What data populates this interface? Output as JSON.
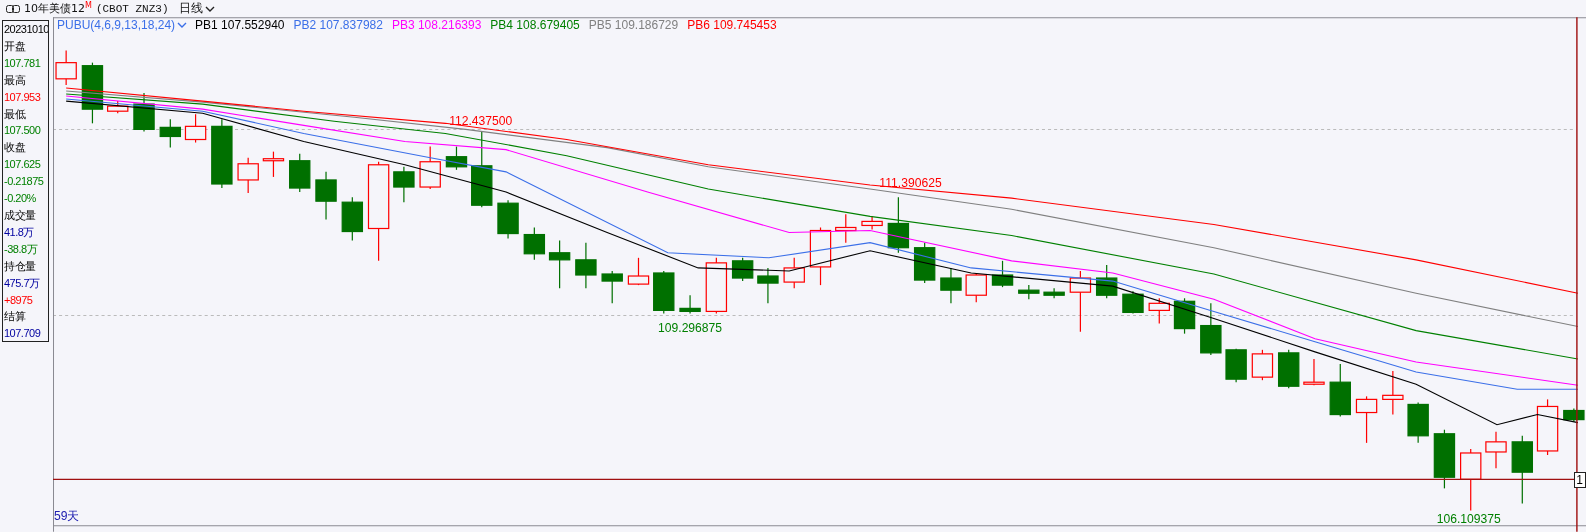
{
  "header": {
    "title": "10年美债12",
    "title_mark": "M",
    "symbol": "(CBOT ZNZ3)",
    "period": "日线"
  },
  "info_panel": [
    {
      "text": "20231010",
      "kind": "label"
    },
    {
      "text": "开盘",
      "kind": "label"
    },
    {
      "text": "107.781",
      "kind": "down"
    },
    {
      "text": "最高",
      "kind": "label"
    },
    {
      "text": "107.953",
      "kind": "up"
    },
    {
      "text": "最低",
      "kind": "label"
    },
    {
      "text": "107.500",
      "kind": "down"
    },
    {
      "text": "收盘",
      "kind": "label"
    },
    {
      "text": "107.625",
      "kind": "down"
    },
    {
      "text": "-0.21875",
      "kind": "down"
    },
    {
      "text": "-0.20%",
      "kind": "down"
    },
    {
      "text": "成交量",
      "kind": "label"
    },
    {
      "text": "41.8万",
      "kind": "neutral"
    },
    {
      "text": "-38.8万",
      "kind": "down"
    },
    {
      "text": "持仓量",
      "kind": "label"
    },
    {
      "text": "475.7万",
      "kind": "neutral"
    },
    {
      "text": "+8975",
      "kind": "up"
    },
    {
      "text": "结算",
      "kind": "label"
    },
    {
      "text": "107.709",
      "kind": "neutral"
    }
  ],
  "indicator": {
    "name": "PUBU(4,6,9,13,18,24)",
    "series": [
      {
        "label": "PB1 107.552940",
        "color": "#000000"
      },
      {
        "label": "PB2 107.837982",
        "color": "#3b6fe8"
      },
      {
        "label": "PB3 108.216393",
        "color": "#ff00ff"
      },
      {
        "label": "PB4 108.679405",
        "color": "#008000"
      },
      {
        "label": "PB5 109.186729",
        "color": "#808080"
      },
      {
        "label": "PB6 109.745453",
        "color": "#ff0000"
      }
    ]
  },
  "price_labels": [
    {
      "text": "112.437500",
      "kind": "high"
    },
    {
      "text": "111.390625",
      "kind": "high"
    },
    {
      "text": "109.296875",
      "kind": "low"
    },
    {
      "text": "106.109375",
      "kind": "low"
    }
  ],
  "current_price_tag": "1",
  "day_count": "59天"
}
